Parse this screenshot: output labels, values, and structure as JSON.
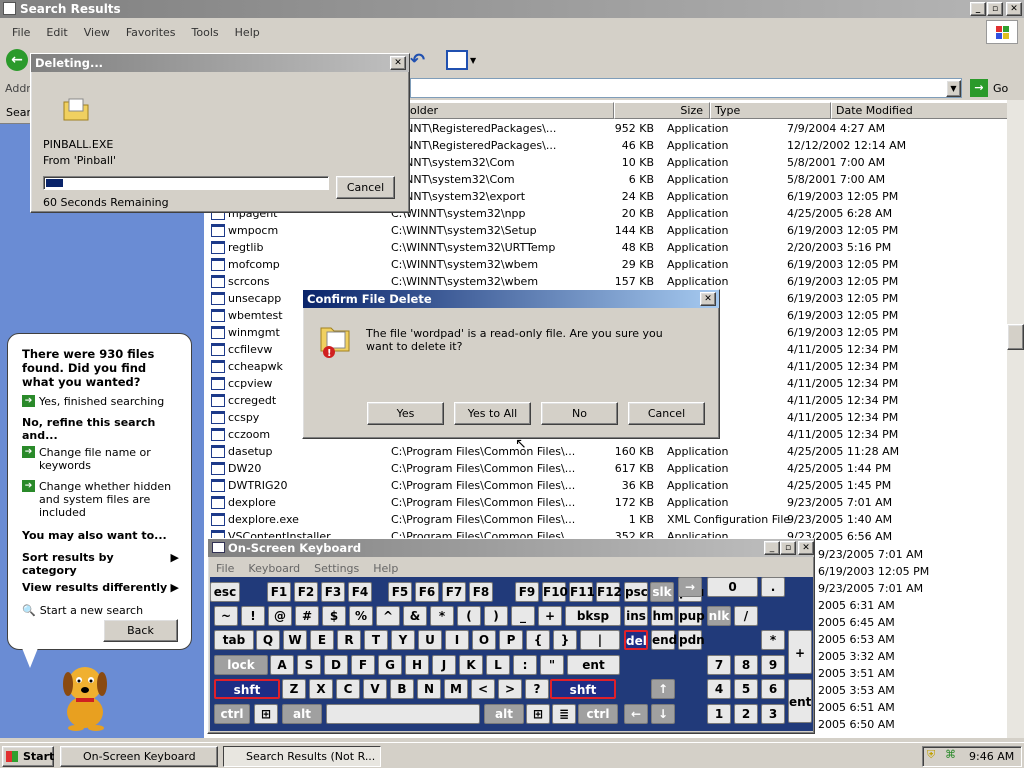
{
  "window": {
    "title": "Search Results"
  },
  "menu": [
    "File",
    "Edit",
    "View",
    "Favorites",
    "Tools",
    "Help"
  ],
  "address": {
    "label": "Addre",
    "go": "Go"
  },
  "search_pane": {
    "header": "Sear",
    "found": "There were 930 files found. Did you find what you wanted?",
    "yes": "Yes, finished searching",
    "refine": "No, refine this search and...",
    "change_name": "Change file name or keywords",
    "change_hidden": "Change whether hidden and system files are included",
    "also": "You may also want to...",
    "sort": "Sort results by category",
    "view": "View results differently",
    "new_search": "Start a new search",
    "back": "Back"
  },
  "columns": {
    "folder": "older",
    "size": "Size",
    "type": "Type",
    "date": "Date Modified"
  },
  "rows": [
    {
      "name": "",
      "folder": "WINNT\\RegisteredPackages\\...",
      "size": "952 KB",
      "type": "Application",
      "date": "7/9/2004 4:27 AM"
    },
    {
      "name": "",
      "folder": "WINNT\\RegisteredPackages\\...",
      "size": "46 KB",
      "type": "Application",
      "date": "12/12/2002 12:14 AM"
    },
    {
      "name": "",
      "folder": "WINNT\\system32\\Com",
      "size": "10 KB",
      "type": "Application",
      "date": "5/8/2001 7:00 AM"
    },
    {
      "name": "",
      "folder": "WINNT\\system32\\Com",
      "size": "6 KB",
      "type": "Application",
      "date": "5/8/2001 7:00 AM"
    },
    {
      "name": "",
      "folder": "WINNT\\system32\\export",
      "size": "24 KB",
      "type": "Application",
      "date": "6/19/2003 12:05 PM"
    },
    {
      "name": "mpagent",
      "folder": "C:\\WINNT\\system32\\npp",
      "size": "20 KB",
      "type": "Application",
      "date": "4/25/2005 6:28 AM"
    },
    {
      "name": "wmpocm",
      "folder": "C:\\WINNT\\system32\\Setup",
      "size": "144 KB",
      "type": "Application",
      "date": "6/19/2003 12:05 PM"
    },
    {
      "name": "regtlib",
      "folder": "C:\\WINNT\\system32\\URTTemp",
      "size": "48 KB",
      "type": "Application",
      "date": "2/20/2003 5:16 PM"
    },
    {
      "name": "mofcomp",
      "folder": "C:\\WINNT\\system32\\wbem",
      "size": "29 KB",
      "type": "Application",
      "date": "6/19/2003 12:05 PM"
    },
    {
      "name": "scrcons",
      "folder": "C:\\WINNT\\system32\\wbem",
      "size": "157 KB",
      "type": "Application",
      "date": "6/19/2003 12:05 PM"
    },
    {
      "name": "unsecapp",
      "folder": "",
      "size": "",
      "type": "",
      "date": "6/19/2003 12:05 PM"
    },
    {
      "name": "wbemtest",
      "folder": "",
      "size": "",
      "type": "",
      "date": "6/19/2003 12:05 PM"
    },
    {
      "name": "winmgmt",
      "folder": "",
      "size": "",
      "type": "",
      "date": "6/19/2003 12:05 PM"
    },
    {
      "name": "ccfilevw",
      "folder": "",
      "size": "",
      "type": "",
      "date": "4/11/2005 12:34 PM"
    },
    {
      "name": "ccheapwk",
      "folder": "",
      "size": "",
      "type": "",
      "date": "4/11/2005 12:34 PM"
    },
    {
      "name": "ccpview",
      "folder": "",
      "size": "",
      "type": "",
      "date": "4/11/2005 12:34 PM"
    },
    {
      "name": "ccregedt",
      "folder": "",
      "size": "",
      "type": "",
      "date": "4/11/2005 12:34 PM"
    },
    {
      "name": "ccspy",
      "folder": "",
      "size": "",
      "type": "",
      "date": "4/11/2005 12:34 PM"
    },
    {
      "name": "cczoom",
      "folder": "",
      "size": "",
      "type": "",
      "date": "4/11/2005 12:34 PM"
    },
    {
      "name": "dasetup",
      "folder": "C:\\Program Files\\Common Files\\...",
      "size": "160 KB",
      "type": "Application",
      "date": "4/25/2005 11:28 AM"
    },
    {
      "name": "DW20",
      "folder": "C:\\Program Files\\Common Files\\...",
      "size": "617 KB",
      "type": "Application",
      "date": "4/25/2005 1:44 PM"
    },
    {
      "name": "DWTRIG20",
      "folder": "C:\\Program Files\\Common Files\\...",
      "size": "36 KB",
      "type": "Application",
      "date": "4/25/2005 1:45 PM"
    },
    {
      "name": "dexplore",
      "folder": "C:\\Program Files\\Common Files\\...",
      "size": "172 KB",
      "type": "Application",
      "date": "9/23/2005 7:01 AM"
    },
    {
      "name": "dexplore.exe",
      "folder": "C:\\Program Files\\Common Files\\...",
      "size": "1 KB",
      "type": "XML Configuration File",
      "date": "9/23/2005 1:40 AM"
    },
    {
      "name": "VSContentInstaller",
      "folder": "C:\\Program Files\\Common Files\\...",
      "size": "352 KB",
      "type": "Application",
      "date": "9/23/2005 6:56 AM"
    }
  ],
  "right_dates": [
    "9/23/2005 7:01 AM",
    "6/19/2003 12:05 PM",
    "9/23/2005 7:01 AM",
    "2005 6:31 AM",
    "2005 6:45 AM",
    "2005 6:53 AM",
    "2005 3:32 AM",
    "2005 3:51 AM",
    "2005 3:53 AM",
    "2005 6:51 AM",
    "2005 6:50 AM"
  ],
  "deleting": {
    "title": "Deleting...",
    "file": "PINBALL.EXE",
    "from": "From 'Pinball'",
    "remaining": "60 Seconds Remaining",
    "cancel": "Cancel",
    "progress": 0.06
  },
  "confirm": {
    "title": "Confirm File Delete",
    "message": "The file 'wordpad' is a read-only file.  Are you sure you want to delete it?",
    "yes": "Yes",
    "yes_all": "Yes to All",
    "no": "No",
    "cancel": "Cancel"
  },
  "osk": {
    "title": "On-Screen Keyboard",
    "menu": [
      "File",
      "Keyboard",
      "Settings",
      "Help"
    ]
  },
  "taskbar": {
    "start": "Start",
    "task1": "On-Screen Keyboard",
    "task2": "Search Results (Not R...",
    "clock": "9:46 AM"
  }
}
